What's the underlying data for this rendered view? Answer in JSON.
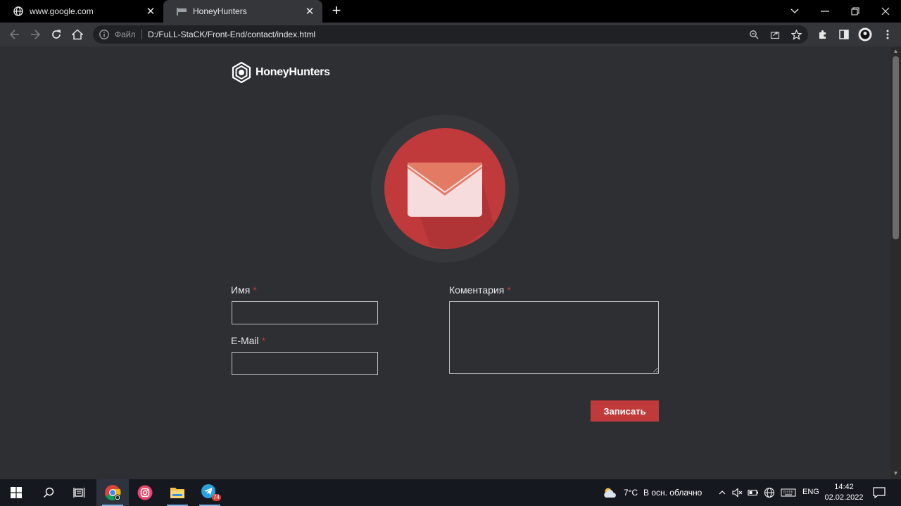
{
  "browser": {
    "tabs": [
      {
        "title": "www.google.com",
        "favicon": "globe-icon"
      },
      {
        "title": "HoneyHunters",
        "favicon": "page-icon"
      }
    ],
    "new_tab_label": "+",
    "address": {
      "info_label": "Файл",
      "url": "D:/FuLL-StaCK/Front-End/contact/index.html"
    }
  },
  "page": {
    "brand": "HoneyHunters",
    "form": {
      "name_label": "Имя",
      "email_label": "E-Mail",
      "comment_label": "Коментария",
      "required_mark": "*",
      "submit_label": "Записать"
    },
    "colors": {
      "accent": "#c0393b",
      "background": "#2d2f33"
    }
  },
  "taskbar": {
    "weather_temp": "7°C",
    "weather_text": "В осн. облачно",
    "language": "ENG",
    "time": "14:42",
    "date": "02.02.2022",
    "telegram_badge": "74"
  }
}
